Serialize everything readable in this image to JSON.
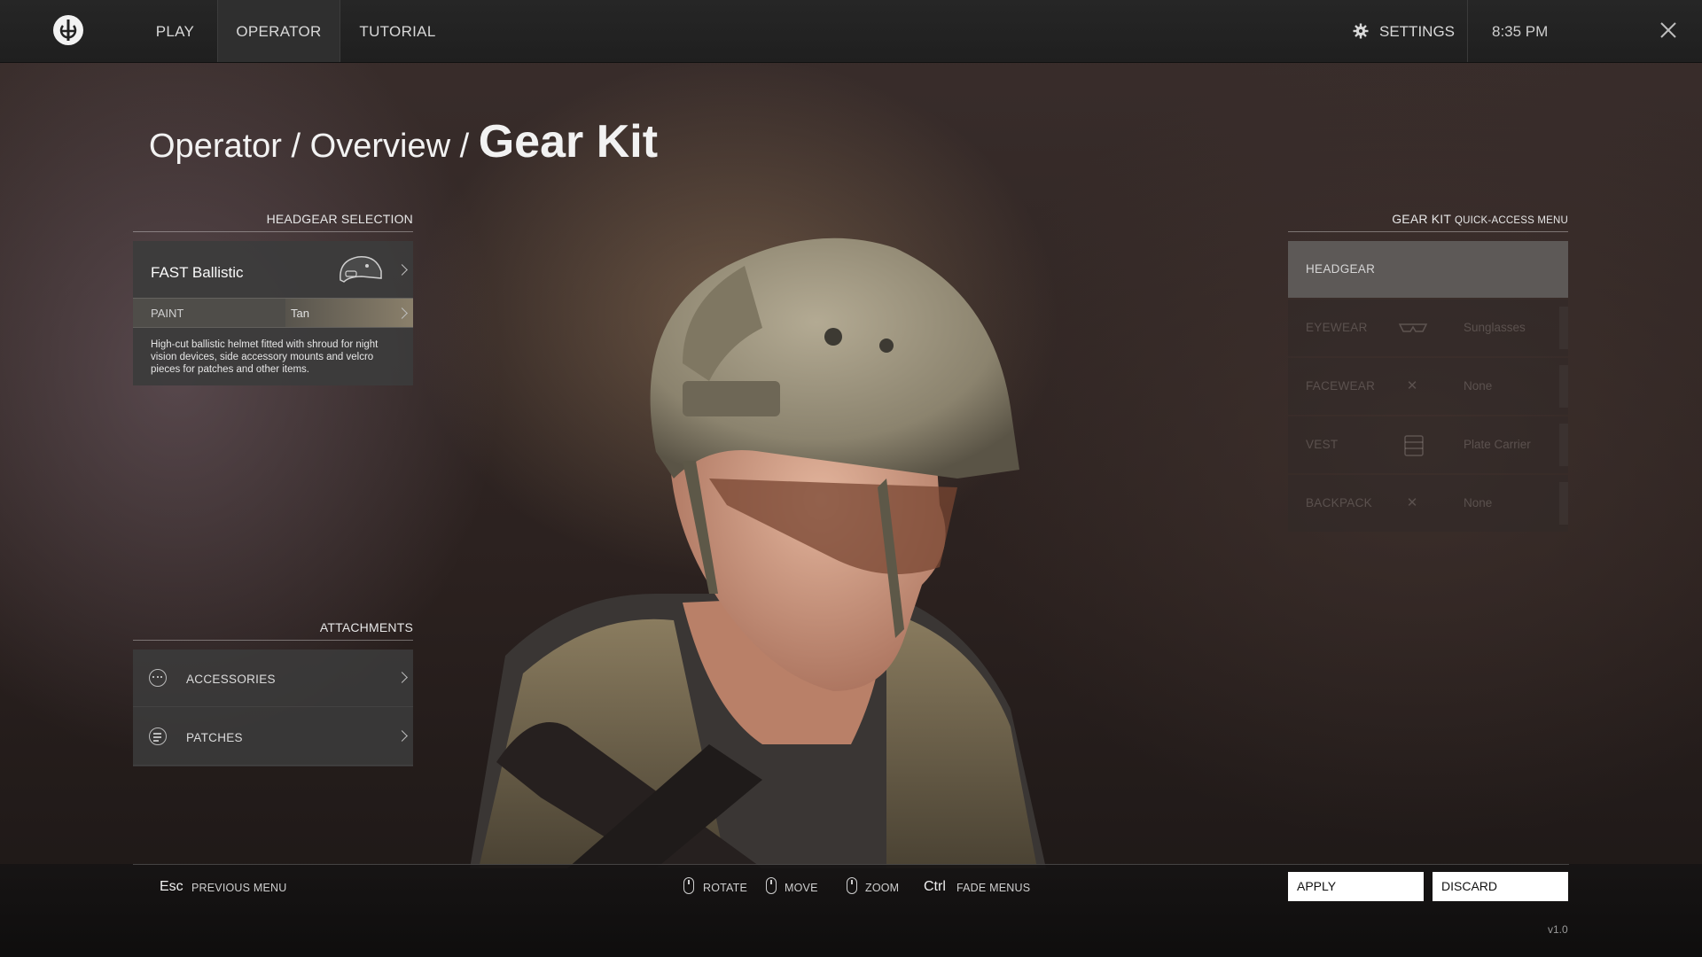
{
  "nav": {
    "tabs": [
      {
        "label": "PLAY",
        "active": false
      },
      {
        "label": "OPERATOR",
        "active": true
      },
      {
        "label": "TUTORIAL",
        "active": false
      }
    ],
    "settings_label": "SETTINGS",
    "clock": "8:35 PM"
  },
  "breadcrumb": {
    "part1": "Operator",
    "sep1": " / ",
    "part2": "Overview",
    "sep2": " / ",
    "current": "Gear Kit"
  },
  "headgear": {
    "section_title": "HEADGEAR SELECTION",
    "name": "FAST Ballistic",
    "paint_label": "PAINT",
    "paint_value": "Tan",
    "description": "High-cut ballistic helmet fitted with shroud for night vision devices, side accessory mounts and velcro pieces for patches and other items."
  },
  "attachments": {
    "section_title": "ATTACHMENTS",
    "items": [
      {
        "label": "ACCESSORIES",
        "icon": "dots-circle-icon"
      },
      {
        "label": "PATCHES",
        "icon": "lines-circle-icon"
      }
    ]
  },
  "quick_access": {
    "title_main": "GEAR KIT",
    "title_sub": "QUICK-ACCESS MENU",
    "items": [
      {
        "category": "HEADGEAR",
        "value": "",
        "icon": "",
        "selected": true
      },
      {
        "category": "EYEWEAR",
        "value": "Sunglasses",
        "icon": "sunglasses-icon",
        "selected": false
      },
      {
        "category": "FACEWEAR",
        "value": "None",
        "icon": "x-icon",
        "selected": false
      },
      {
        "category": "VEST",
        "value": "Plate Carrier",
        "icon": "vest-icon",
        "selected": false
      },
      {
        "category": "BACKPACK",
        "value": "None",
        "icon": "x-icon",
        "selected": false
      }
    ]
  },
  "footer": {
    "esc_key": "Esc",
    "esc_hint": "PREVIOUS MENU",
    "rotate": "ROTATE",
    "move": "MOVE",
    "zoom": "ZOOM",
    "ctrl_key": "Ctrl",
    "ctrl_hint": "FADE MENUS",
    "apply": "APPLY",
    "discard": "DISCARD",
    "version": "v1.0"
  }
}
